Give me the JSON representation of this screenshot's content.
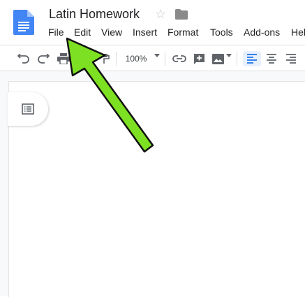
{
  "document": {
    "title": "Latin Homework"
  },
  "menu": {
    "items": [
      "File",
      "Edit",
      "View",
      "Insert",
      "Format",
      "Tools",
      "Add-ons",
      "Help"
    ]
  },
  "toolbar": {
    "zoom": "100%"
  },
  "colors": {
    "docs_blue": "#4285f4",
    "arrow_green": "#7ee022",
    "active_align_bg": "#e8f0fe"
  },
  "icons": {
    "header": [
      "docs-logo-icon",
      "star-icon",
      "folder-icon"
    ],
    "toolbar": [
      "undo-icon",
      "redo-icon",
      "print-icon",
      "paint-format-icon",
      "insert-link-icon",
      "insert-comment-icon",
      "insert-image-icon",
      "align-left-icon",
      "align-center-icon",
      "align-right-icon"
    ],
    "side": [
      "document-outline-icon"
    ]
  }
}
